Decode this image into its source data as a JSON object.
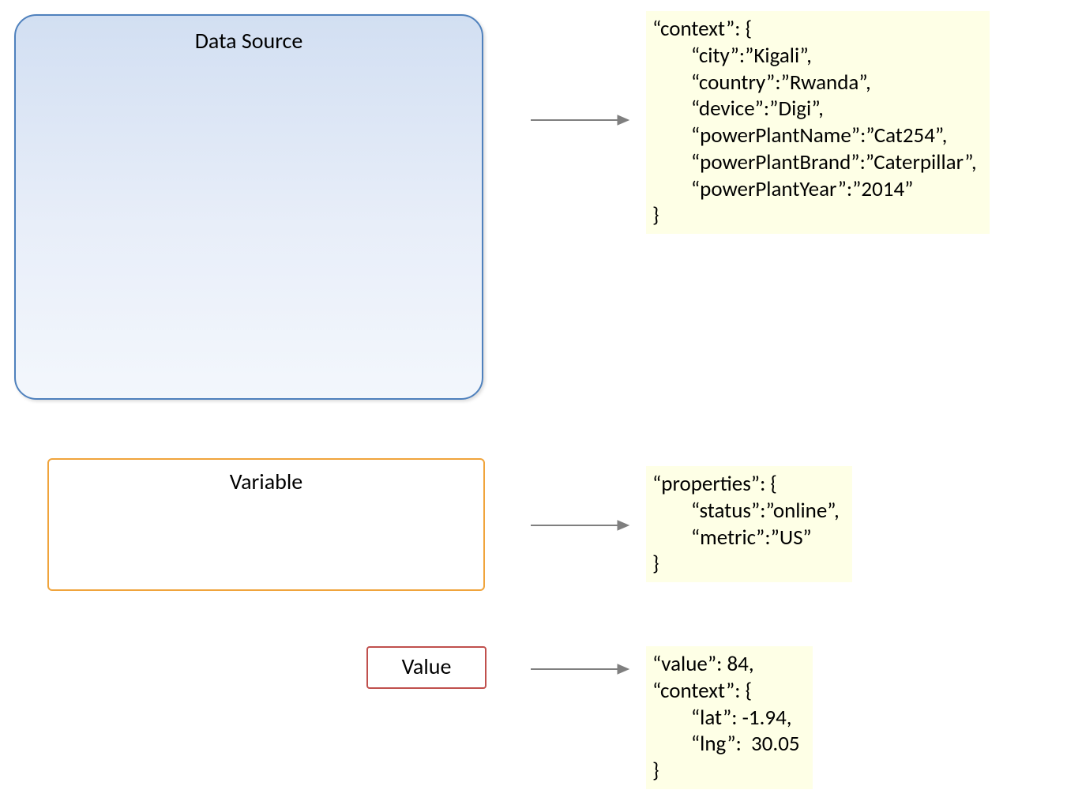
{
  "boxes": {
    "data_source_label": "Data Source",
    "variable_label": "Variable",
    "value_label": "Value"
  },
  "code": {
    "context_block": "“context”: {\n        “city”:”Kigali”,\n        “country”:”Rwanda”,\n        “device”:”Digi”,\n        “powerPlantName”:”Cat254”,\n        “powerPlantBrand”:”Caterpillar”,\n        “powerPlantYear”:”2014”\n}",
    "properties_block": "“properties”: {\n        “status”:”online”,\n        “metric”:”US”\n}",
    "value_block": "“value”: 84,\n“context”: {\n        “lat”: -1.94,\n        “lng”:  30.05\n}"
  }
}
